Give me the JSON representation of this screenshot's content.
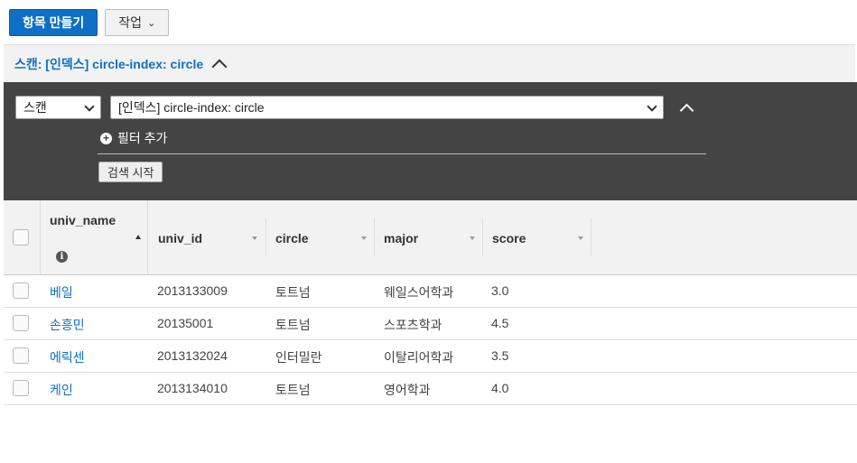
{
  "toolbar": {
    "create_label": "항목 만들기",
    "actions_label": "작업"
  },
  "section": {
    "title": "스캔: [인덱스] circle-index: circle"
  },
  "filter": {
    "mode_value": "스캔",
    "index_value": "[인덱스] circle-index: circle",
    "add_filter_label": "필터 추가",
    "search_label": "검색 시작"
  },
  "table": {
    "columns": [
      "univ_name",
      "univ_id",
      "circle",
      "major",
      "score"
    ],
    "rows": [
      {
        "univ_name": "베일",
        "univ_id": "2013133009",
        "circle": "토트넘",
        "major": "웨일스어학과",
        "score": "3.0"
      },
      {
        "univ_name": "손흥민",
        "univ_id": "20135001",
        "circle": "토트넘",
        "major": "스포츠학과",
        "score": "4.5"
      },
      {
        "univ_name": "에릭센",
        "univ_id": "2013132024",
        "circle": "인터밀란",
        "major": "이탈리어학과",
        "score": "3.5"
      },
      {
        "univ_name": "케인",
        "univ_id": "2013134010",
        "circle": "토트넘",
        "major": "영어학과",
        "score": "4.0"
      }
    ]
  },
  "colors": {
    "accent": "#0f6fc6",
    "panel": "#444444"
  },
  "icons": {
    "actions": "chevron-down-icon",
    "collapse": "chevron-up-icon",
    "add": "plus-circle-icon",
    "info": "info-icon"
  }
}
